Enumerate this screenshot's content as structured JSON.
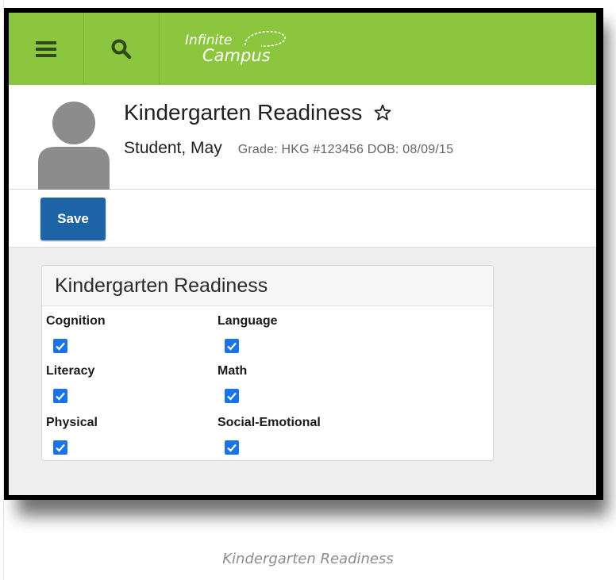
{
  "app": {
    "logo_line1": "Infinite",
    "logo_line2": "Campus",
    "brand_color": "#8cc63f",
    "menu_icon": "hamburger-menu-icon",
    "search_icon": "search-icon"
  },
  "header": {
    "title": "Kindergarten Readiness",
    "star_icon": "star-outline-icon",
    "student_name": "Student, May",
    "student_meta": "Grade: HKG #123456 DOB: 08/09/15"
  },
  "toolbar": {
    "save_label": "Save",
    "save_color": "#1d64a6"
  },
  "panel": {
    "title": "Kindergarten Readiness",
    "fields": [
      {
        "label": "Cognition",
        "checked": true
      },
      {
        "label": "Language",
        "checked": true
      },
      {
        "label": "Literacy",
        "checked": true
      },
      {
        "label": "Math",
        "checked": true
      },
      {
        "label": "Physical",
        "checked": true
      },
      {
        "label": "Social-Emotional",
        "checked": true
      }
    ]
  },
  "caption": "Kindergarten Readiness"
}
